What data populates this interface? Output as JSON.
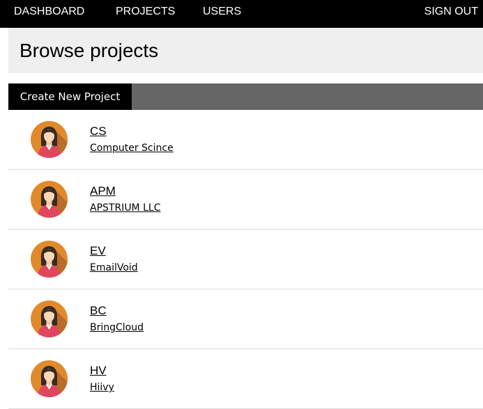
{
  "nav": {
    "dashboard": "DASHBOARD",
    "projects": "PROJECTS",
    "users": "USERS",
    "sign_out": "SIGN OUT"
  },
  "page": {
    "title": "Browse projects"
  },
  "toolbar": {
    "create_label": "Create New Project"
  },
  "projects": [
    {
      "code": "CS",
      "name": "Computer Scince",
      "icon": "user-avatar-icon"
    },
    {
      "code": "APM",
      "name": "APSTRIUM LLC",
      "icon": "user-avatar-icon"
    },
    {
      "code": "EV",
      "name": "EmailVoid",
      "icon": "user-avatar-icon"
    },
    {
      "code": "BC",
      "name": "BringCloud",
      "icon": "user-avatar-icon"
    },
    {
      "code": "HV",
      "name": "Hiivy",
      "icon": "user-avatar-icon"
    }
  ],
  "colors": {
    "nav_bg": "#000000",
    "title_bar_bg": "#efefef",
    "toolbar_bg": "#666666",
    "button_bg": "#000000",
    "avatar_bg": "#e08a2c",
    "avatar_shirt": "#e0475f"
  }
}
